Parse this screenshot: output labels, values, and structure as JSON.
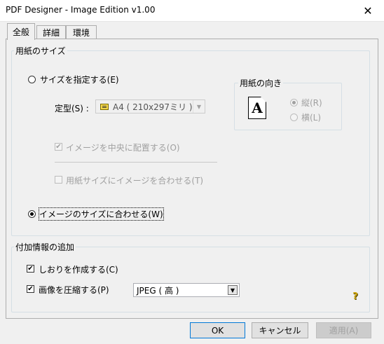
{
  "window": {
    "title": "PDF Designer - Image Edition v1.00",
    "close_glyph": "✕"
  },
  "tabs": [
    {
      "label": "全般",
      "active": true
    },
    {
      "label": "詳細",
      "active": false
    },
    {
      "label": "環境",
      "active": false
    }
  ],
  "paper_size": {
    "group_title": "用紙のサイズ",
    "specify_size_radio": {
      "label": "サイズを指定する(E)",
      "checked": false
    },
    "standard_label": "定型(S) :",
    "standard_combo": {
      "value": "A4 ( 210x297ミリ )",
      "icon": "paper-size-icon"
    },
    "center_checkbox": {
      "label": "イメージを中央に配置する(O)",
      "checked": true,
      "enabled": false
    },
    "fit_checkbox": {
      "label": "用紙サイズにイメージを合わせる(T)",
      "checked": false,
      "enabled": false
    },
    "match_image_radio": {
      "label": "イメージのサイズに合わせる(W)",
      "checked": true
    },
    "orientation": {
      "group_title": "用紙の向き",
      "icon_letter": "A",
      "portrait": {
        "label": "縦(R)",
        "checked": true
      },
      "landscape": {
        "label": "横(L)",
        "checked": false
      }
    }
  },
  "additional_info": {
    "group_title": "付加情報の追加",
    "bookmark_checkbox": {
      "label": "しおりを作成する(C)",
      "checked": true
    },
    "compress_checkbox": {
      "label": "画像を圧縮する(P)",
      "checked": true
    },
    "compression_combo": {
      "value": "JPEG ( 高 )"
    },
    "help_icon": "?"
  },
  "buttons": {
    "ok": "OK",
    "cancel": "キャンセル",
    "apply": "適用(A)"
  }
}
